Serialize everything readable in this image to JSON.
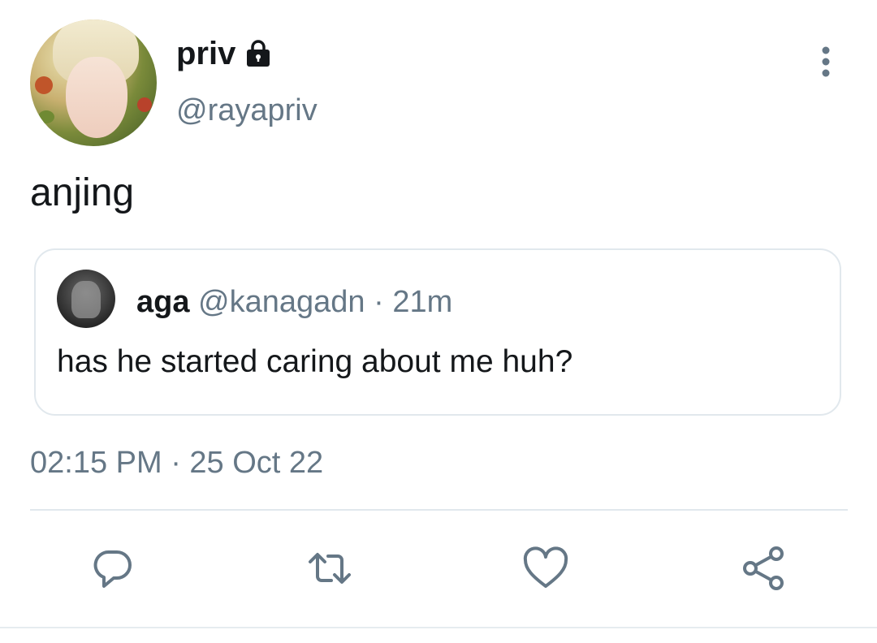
{
  "author": {
    "display_name": "priv",
    "handle": "@rayapriv",
    "protected_icon": "lock-icon",
    "avatar_icon": "user-avatar"
  },
  "tweet": {
    "text": "anjing",
    "timestamp": "02:15 PM · 25 Oct 22"
  },
  "quoted_tweet": {
    "display_name": "aga",
    "meta": "@kanagadn · 21m",
    "text": "has he started caring about me huh?"
  },
  "actions": [
    {
      "name": "reply",
      "icon": "reply-icon"
    },
    {
      "name": "retweet",
      "icon": "retweet-icon"
    },
    {
      "name": "like",
      "icon": "heart-icon"
    },
    {
      "name": "share",
      "icon": "share-icon"
    }
  ],
  "colors": {
    "primary_text": "#14171a",
    "secondary_text": "#657786",
    "icon": "#657786",
    "border": "#e1e8ed"
  }
}
